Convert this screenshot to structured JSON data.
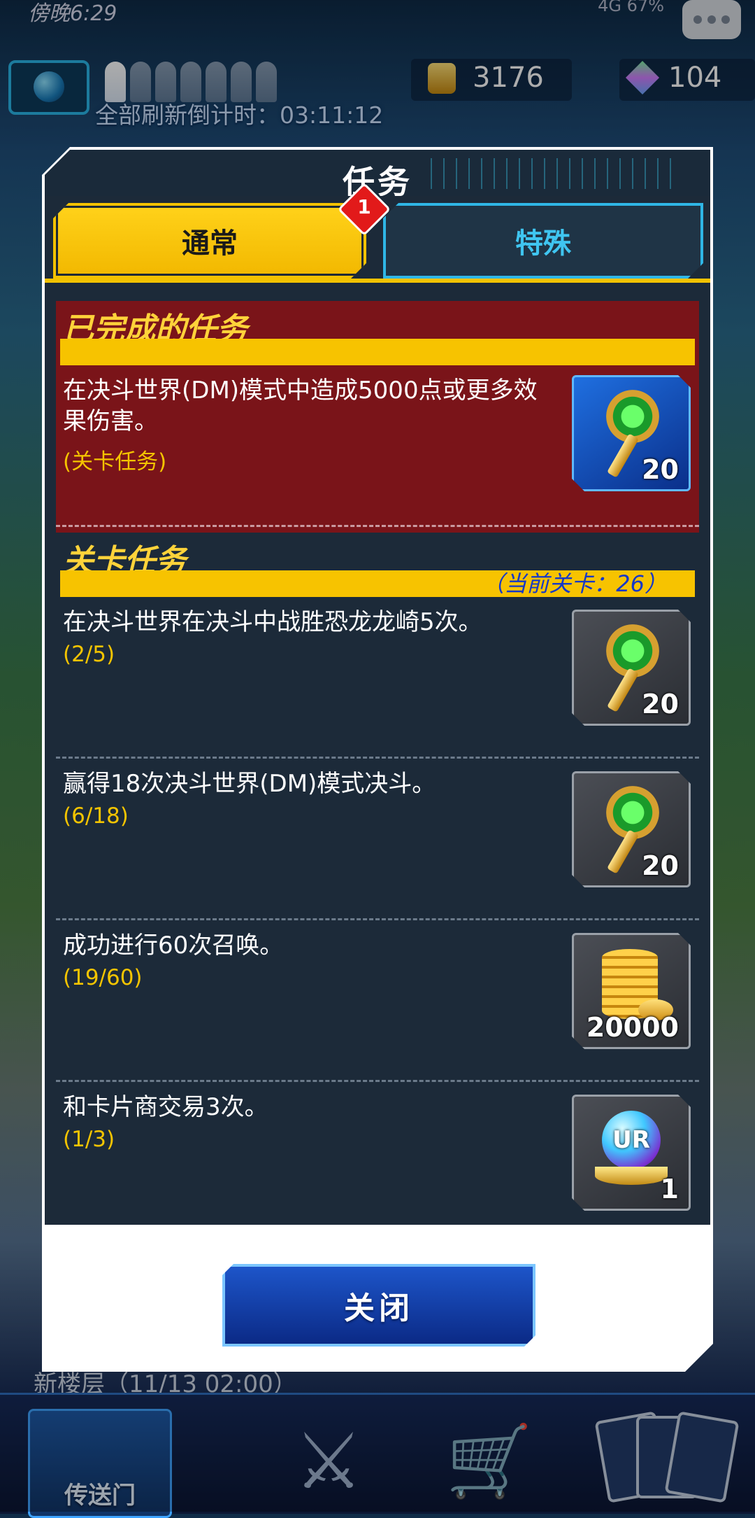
{
  "status_bar": {
    "time": "傍晚6:29",
    "right": "4G 67%"
  },
  "top_bar": {
    "coins": "3176",
    "gems": "104",
    "refresh": "全部刷新倒计时：03:11:12"
  },
  "background": {
    "event_text": "新楼层（11/13 02:00）",
    "nav_portal": "传送门"
  },
  "dialog": {
    "title": "任务",
    "tabs": [
      {
        "label": "通常",
        "active": true,
        "badge": "1"
      },
      {
        "label": "特殊",
        "active": false
      }
    ],
    "completed_section": {
      "title": "已完成的任务",
      "items": [
        {
          "desc": "在决斗世界(DM)模式中造成5000点或更多效果伤害。",
          "progress": "(关卡任务)",
          "reward_icon": "gate-key-icon",
          "reward_qty": "20"
        }
      ]
    },
    "stage_section": {
      "title": "关卡任务",
      "current_stage": "（当前关卡：26）",
      "items": [
        {
          "desc": "在决斗世界在决斗中战胜恐龙龙崎5次。",
          "progress": "(2/5)",
          "reward_icon": "gate-key-icon",
          "reward_qty": "20"
        },
        {
          "desc": "赢得18次决斗世界(DM)模式决斗。",
          "progress": "(6/18)",
          "reward_icon": "gate-key-icon",
          "reward_qty": "20"
        },
        {
          "desc": "成功进行60次召唤。",
          "progress": "(19/60)",
          "reward_icon": "gold-coins-icon",
          "reward_qty": "20000"
        },
        {
          "desc": "和卡片商交易3次。",
          "progress": "(1/3)",
          "reward_icon": "ur-ticket-icon",
          "reward_label": "UR",
          "reward_qty": "1"
        }
      ]
    },
    "close_label": "关闭"
  }
}
